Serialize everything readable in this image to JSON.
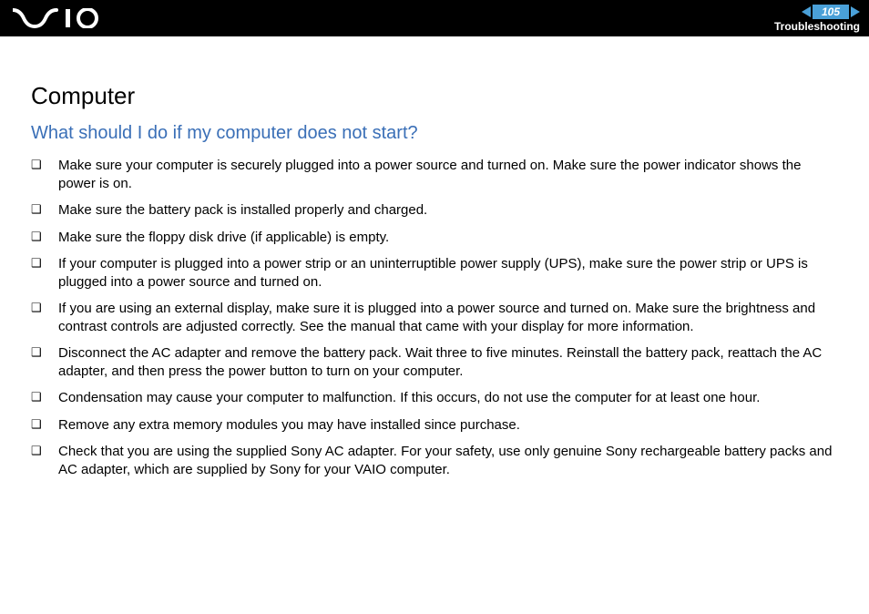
{
  "header": {
    "page_number": "105",
    "section": "Troubleshooting"
  },
  "content": {
    "heading": "Computer",
    "subheading": "What should I do if my computer does not start?",
    "items": [
      "Make sure your computer is securely plugged into a power source and turned on. Make sure the power indicator shows the power is on.",
      "Make sure the battery pack is installed properly and charged.",
      "Make sure the floppy disk drive (if applicable) is empty.",
      "If your computer is plugged into a power strip or an uninterruptible power supply (UPS), make sure the power strip or UPS is plugged into a power source and turned on.",
      "If you are using an external display, make sure it is plugged into a power source and turned on. Make sure the brightness and contrast controls are adjusted correctly. See the manual that came with your display for more information.",
      "Disconnect the AC adapter and remove the battery pack. Wait three to five minutes. Reinstall the battery pack, reattach the AC adapter, and then press the power button to turn on your computer.",
      "Condensation may cause your computer to malfunction. If this occurs, do not use the computer for at least one hour.",
      "Remove any extra memory modules you may have installed since purchase.",
      "Check that you are using the supplied Sony AC adapter. For your safety, use only genuine Sony rechargeable battery packs and AC adapter, which are supplied by Sony for your VAIO computer."
    ]
  }
}
